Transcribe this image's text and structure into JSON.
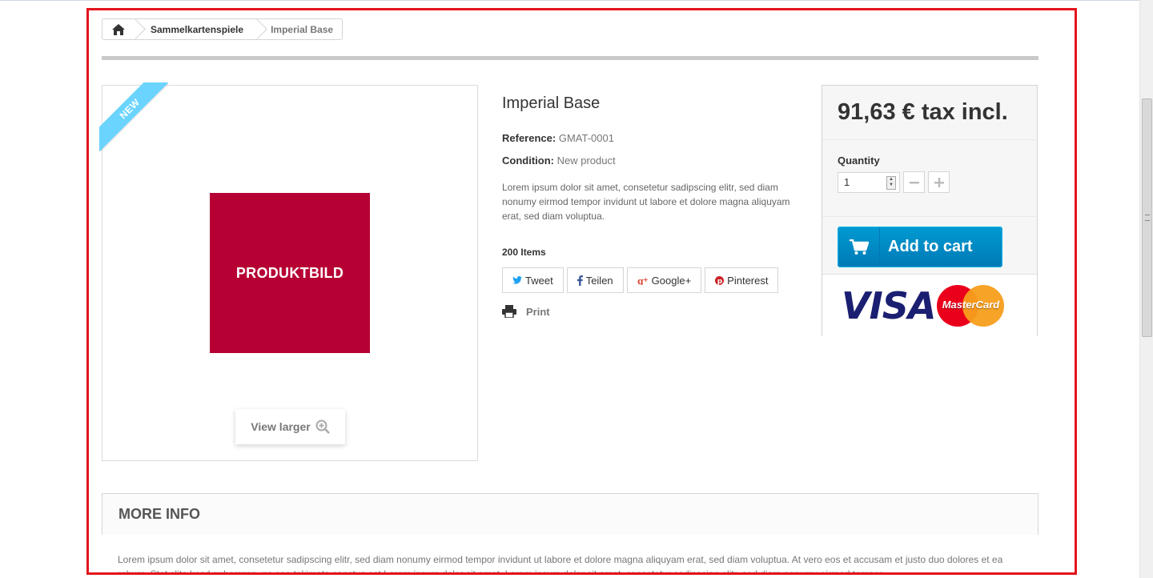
{
  "breadcrumb": {
    "category": "Sammelkartenspiele",
    "current": "Imperial Base"
  },
  "product": {
    "badge": "NEW",
    "image_label": "PRODUKTBILD",
    "view_larger": "View larger",
    "title": "Imperial Base",
    "reference_label": "Reference:",
    "reference_value": "GMAT-0001",
    "condition_label": "Condition:",
    "condition_value": "New product",
    "description": "Lorem ipsum dolor sit amet, consetetur sadipscing elitr, sed diam nonumy eirmod tempor invidunt ut labore et dolore magna aliquyam erat, sed diam voluptua.",
    "stock": "200 Items"
  },
  "share": {
    "tweet": "Tweet",
    "teilen": "Teilen",
    "googleplus": "Google+",
    "pinterest": "Pinterest",
    "print": "Print"
  },
  "buy_box": {
    "price": "91,63 € tax incl.",
    "quantity_label": "Quantity",
    "quantity_value": "1",
    "add_to_cart": "Add to cart",
    "visa": "VISA",
    "mastercard": "MasterCard"
  },
  "more_info": {
    "title": "MORE INFO",
    "text": "Lorem ipsum dolor sit amet, consetetur sadipscing elitr, sed diam nonumy eirmod tempor invidunt ut labore et dolore magna aliquyam erat, sed diam voluptua. At vero eos et accusam et justo duo dolores et ea rebum. Stet clita kasd gubergren, no sea takimata sanctus est Lorem ipsum dolor sit amet. Lorem ipsum dolor sit amet, consetetur sadipscing elitr, sed diam nonumy eirmod tempor"
  },
  "colors": {
    "frame": "#e3141b",
    "ribbon": "#6ad4ff",
    "product_image": "#b60034",
    "cart_button": "#009ad0"
  }
}
